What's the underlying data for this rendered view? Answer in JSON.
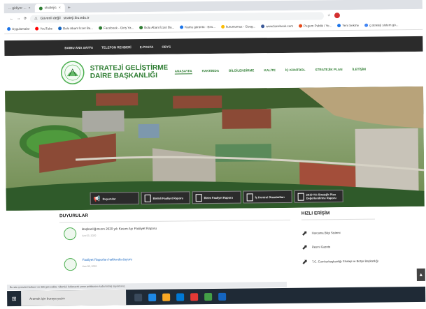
{
  "browser": {
    "tabs": [
      {
        "label": "... gidiyor ..."
      },
      {
        "label": "stratejis"
      }
    ],
    "address_prefix": "Güvenli değil",
    "address_url": "strateji.ibu.edu.tr",
    "bookmarks": [
      "Uygulamalar",
      "YouTube",
      "Bolu Abant İzzet Ba...",
      "Facebook - Giriş Ya...",
      "Bolu Abant İzzet Ba...",
      "Kamu görüntü - Ens...",
      "kurumumuz - Goog...",
      "www.facebook.com",
      "Pegem Publik / Ye...",
      "Yeni Sekme",
      "g strateji sistem gö..."
    ]
  },
  "topnav": [
    "BAIBU ANA SAYFA",
    "TELEFON REHBERİ",
    "E-POSTA",
    "OBYS"
  ],
  "header": {
    "title_line1": "STRATEJİ GELİŞTİRME",
    "title_line2": "DAİRE BAŞKANLIĞI",
    "menu": [
      "ANASAYFA",
      "HAKKINDA",
      "BİLGİLENDİRME",
      "KALİTE",
      "İÇ KONTROL",
      "STRATEJİK PLAN",
      "İLETİŞİM"
    ]
  },
  "quickbar": [
    {
      "label": "Duyurular"
    },
    {
      "label": "Birlikli Faaliyet Raporu"
    },
    {
      "label": "Birim Faaliyet Raporu"
    },
    {
      "label": "İç Kontrol Standartları"
    },
    {
      "label": "2019 Yılı Stratejik Plan Değerlendirme Raporu"
    }
  ],
  "announcements": {
    "title": "DUYURULAR",
    "items": [
      {
        "title": "Başkanlığımızın 2020 yılı Kasım Ayı Faaliyet Raporu",
        "date": "Ara 03, 2020"
      },
      {
        "title": "Faaliyet Raporları hakkında duyuru",
        "date": "Kas 09, 2020"
      }
    ]
  },
  "quick_access": {
    "title": "HIZLI ERİŞİM",
    "items": [
      "Harcama Bilgi Sistemi",
      "Resmi Gazete",
      "T.C. Cumhurbaşkanlığı Strateji ve Bütçe Başkanlığı"
    ]
  },
  "status_text": "Bu site çerezleri kullanır ve 365 gün saklar. Sitemizi kullanarak çerez politikasını kabul etmiş sayılırsınız.",
  "taskbar": {
    "search_placeholder": "Aramak için buraya yazın",
    "time": "",
    "date": ""
  }
}
